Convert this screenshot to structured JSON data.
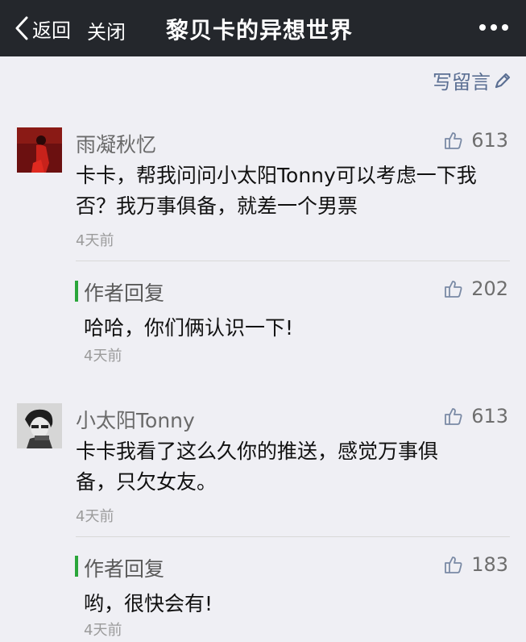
{
  "navbar": {
    "back_label": "返回",
    "close_label": "关闭",
    "title": "黎贝卡的异想世界"
  },
  "write_comment_label": "写留言",
  "comments": [
    {
      "nickname": "雨凝秋忆",
      "likes": "613",
      "content_line1": "卡卡，帮我问问小太阳Tonny可以考虑一下我",
      "content_line2": "否？我万事俱备，就差一个男票",
      "time": "4天前",
      "reply": {
        "label": "作者回复",
        "likes": "202",
        "content": "哈哈，你们俩认识一下!",
        "time": "4天前"
      }
    },
    {
      "nickname": "小太阳Tonny",
      "likes": "613",
      "content_line1": "卡卡我看了这么久你的推送，感觉万事俱",
      "content_line2": "备，只欠女友。",
      "time": "4天前",
      "reply": {
        "label": "作者回复",
        "likes": "183",
        "content": "哟，很快会有!",
        "time": "4天前"
      }
    }
  ],
  "colors": {
    "navbar_bg": "#24272c",
    "page_bg": "#efeff4",
    "link_blue": "#5b6f93",
    "reply_green": "#2aa63a"
  }
}
